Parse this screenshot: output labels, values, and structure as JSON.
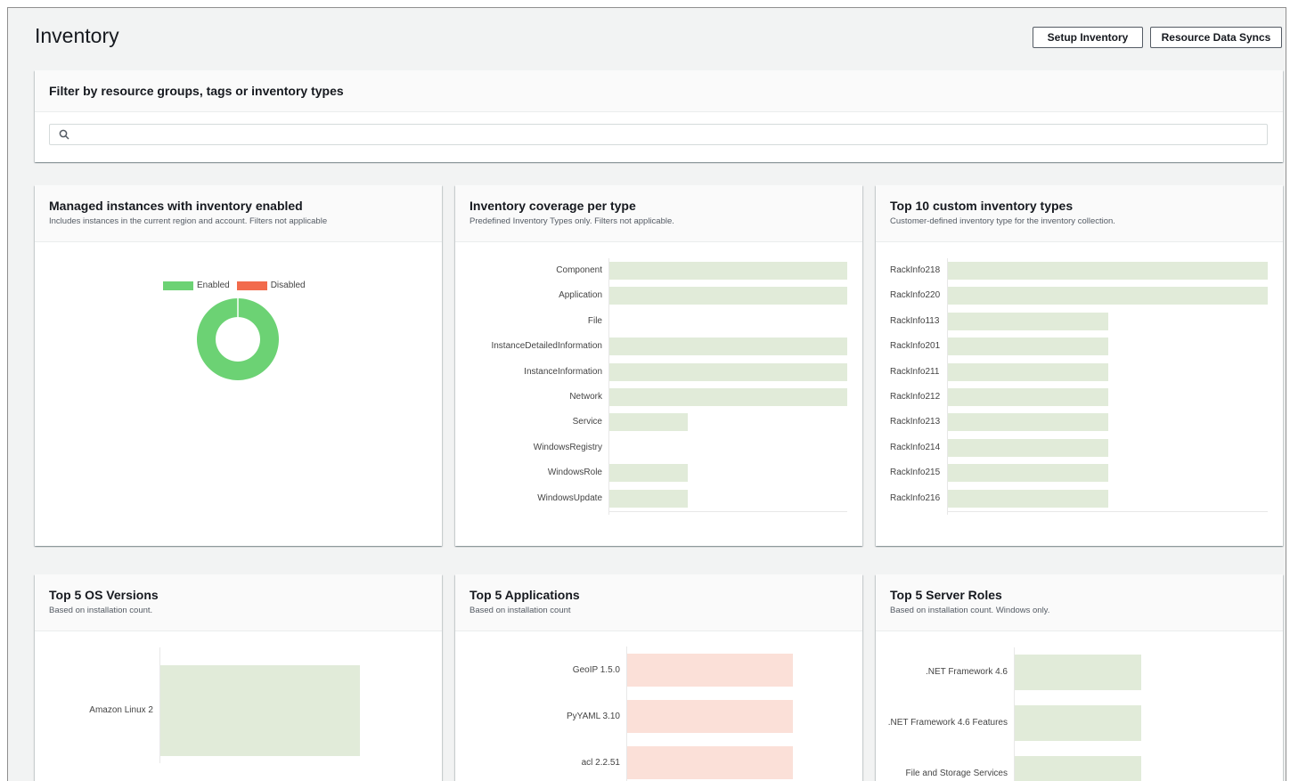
{
  "header": {
    "title": "Inventory",
    "setup_button": "Setup Inventory",
    "sync_button": "Resource Data Syncs"
  },
  "filter": {
    "title": "Filter by resource groups, tags or inventory types",
    "placeholder": ""
  },
  "colors": {
    "enabled": "#6cd274",
    "disabled": "#f26b4c",
    "bar_green": "#e1ebd9",
    "bar_pink": "#fbe0d8"
  },
  "cards": {
    "managed": {
      "title": "Managed instances with inventory enabled",
      "subtitle": "Includes instances in the current region and account. Filters not applicable",
      "legend": [
        "Enabled",
        "Disabled"
      ],
      "chart_data": {
        "type": "pie",
        "categories": [
          "Enabled",
          "Disabled"
        ],
        "values": [
          100,
          0
        ]
      }
    },
    "coverage": {
      "title": "Inventory coverage per type",
      "subtitle": "Predefined Inventory Types only. Filters not applicable.",
      "chart_data": {
        "type": "bar",
        "categories": [
          "Component",
          "Application",
          "File",
          "InstanceDetailedInformation",
          "InstanceInformation",
          "Network",
          "Service",
          "WindowsRegistry",
          "WindowsRole",
          "WindowsUpdate"
        ],
        "values": [
          100,
          100,
          0,
          100,
          100,
          100,
          33,
          0,
          33,
          33
        ]
      }
    },
    "custom": {
      "title": "Top 10 custom inventory types",
      "subtitle": "Customer-defined inventory type for the inventory collection.",
      "chart_data": {
        "type": "bar",
        "categories": [
          "RackInfo218",
          "RackInfo220",
          "RackInfo113",
          "RackInfo201",
          "RackInfo211",
          "RackInfo212",
          "RackInfo213",
          "RackInfo214",
          "RackInfo215",
          "RackInfo216"
        ],
        "values": [
          2,
          2,
          1,
          1,
          1,
          1,
          1,
          1,
          1,
          1
        ]
      }
    },
    "os": {
      "title": "Top 5 OS Versions",
      "subtitle": "Based on installation count.",
      "chart_data": {
        "type": "bar",
        "categories": [
          "Amazon Linux 2"
        ],
        "values": [
          1
        ]
      }
    },
    "apps": {
      "title": "Top 5 Applications",
      "subtitle": "Based on installation count",
      "chart_data": {
        "type": "bar",
        "categories": [
          "GeoIP 1.5.0",
          "PyYAML 3.10",
          "acl 2.2.51"
        ],
        "values": [
          1,
          1,
          1
        ]
      }
    },
    "roles": {
      "title": "Top 5 Server Roles",
      "subtitle": "Based on installation count. Windows only.",
      "chart_data": {
        "type": "bar",
        "categories": [
          ".NET Framework 4.6",
          ".NET Framework 4.6 Features",
          "File and Storage Services"
        ],
        "values": [
          1,
          1,
          1
        ]
      }
    }
  }
}
